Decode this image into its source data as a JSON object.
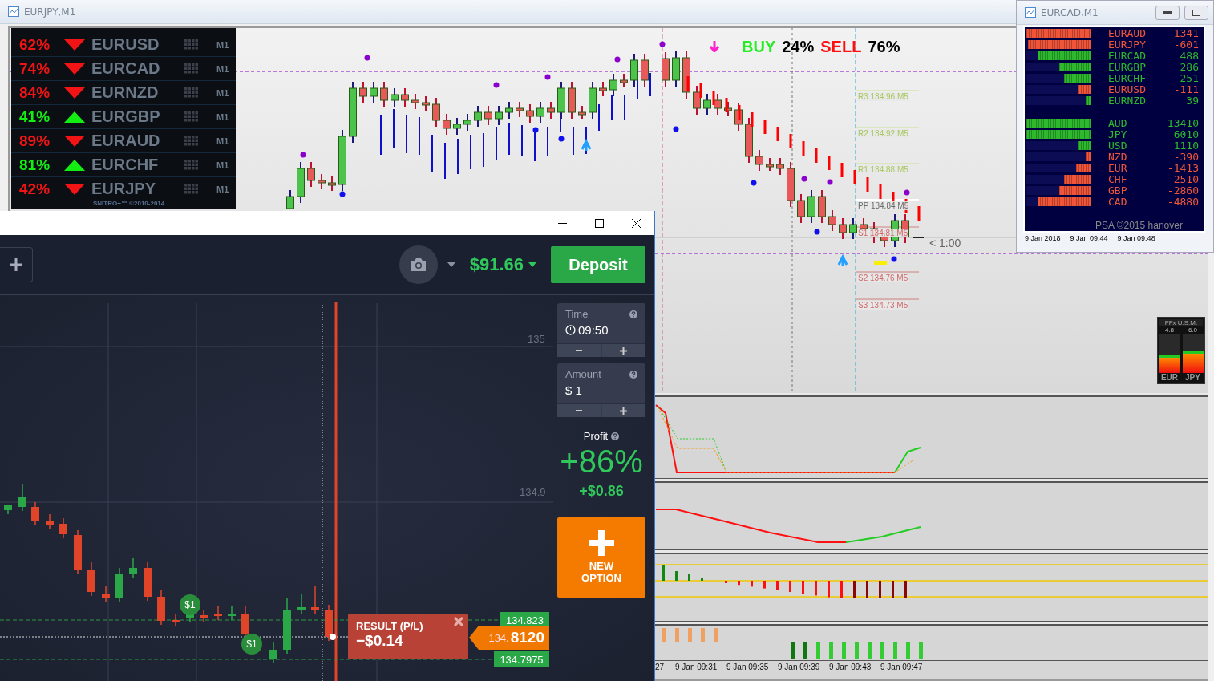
{
  "main_window": {
    "title": "EURJPY,M1"
  },
  "signals": {
    "rows": [
      {
        "percent": "62%",
        "rising": false,
        "pair": "EURUSD",
        "timeframe": "M1"
      },
      {
        "percent": "74%",
        "rising": false,
        "pair": "EURCAD",
        "timeframe": "M1"
      },
      {
        "percent": "84%",
        "rising": false,
        "pair": "EURNZD",
        "timeframe": "M1"
      },
      {
        "percent": "41%",
        "rising": true,
        "pair": "EURGBP",
        "timeframe": "M1"
      },
      {
        "percent": "89%",
        "rising": false,
        "pair": "EURAUD",
        "timeframe": "M1"
      },
      {
        "percent": "81%",
        "rising": true,
        "pair": "EURCHF",
        "timeframe": "M1"
      },
      {
        "percent": "42%",
        "rising": false,
        "pair": "EURJPY",
        "timeframe": "M1"
      }
    ],
    "credit": "SNITRO+™ ©2010-2014"
  },
  "sentiment": {
    "buy_label": "BUY",
    "buy_value": "24%",
    "sell_label": "SELL",
    "sell_value": "76%"
  },
  "pivots": [
    {
      "label": "R3 134.96 M5",
      "kind": "resistance"
    },
    {
      "label": "R2 134.92 M5",
      "kind": "resistance"
    },
    {
      "label": "R1 134.88 M5",
      "kind": "resistance"
    },
    {
      "label": "PP 134.84 M5",
      "kind": "pivot"
    },
    {
      "label": "S1 134.81 M5",
      "kind": "support"
    },
    {
      "label": "S2 134.76 M5",
      "kind": "support"
    },
    {
      "label": "S3 134.73 M5",
      "kind": "support"
    }
  ],
  "countdown": "< 1:00",
  "strength_meter": {
    "title": "FFx U.S.M.",
    "columns": [
      {
        "value": "4.8",
        "currency": "EUR",
        "level": 0.45
      },
      {
        "value": "6.0",
        "currency": "JPY",
        "level": 0.55
      }
    ]
  },
  "time_axis": [
    "27",
    "9 Jan 09:31",
    "9 Jan 09:35",
    "9 Jan 09:39",
    "9 Jan 09:43",
    "9 Jan 09:47"
  ],
  "strength_window": {
    "title": "EURCAD,M1",
    "pairs": [
      {
        "name": "EURAUD",
        "value": "-1341",
        "level": 1.0,
        "color": "#f0553a"
      },
      {
        "name": "EURJPY",
        "value": "-601",
        "level": 0.98,
        "color": "#f0553a"
      },
      {
        "name": "EURCAD",
        "value": "488",
        "level": 0.83,
        "color": "#2db82d"
      },
      {
        "name": "EURGBP",
        "value": "286",
        "level": 0.49,
        "color": "#2db82d"
      },
      {
        "name": "EURCHF",
        "value": "251",
        "level": 0.41,
        "color": "#2db82d"
      },
      {
        "name": "EURUSD",
        "value": "-111",
        "level": 0.19,
        "color": "#f0553a"
      },
      {
        "name": "EURNZD",
        "value": "39",
        "level": 0.08,
        "color": "#2db82d"
      }
    ],
    "currencies": [
      {
        "name": "AUD",
        "value": "13410",
        "level": 1.0,
        "color": "#2db82d"
      },
      {
        "name": "JPY",
        "value": "6010",
        "level": 1.0,
        "color": "#2db82d"
      },
      {
        "name": "USD",
        "value": "1110",
        "level": 0.19,
        "color": "#2db82d"
      },
      {
        "name": "NZD",
        "value": "-390",
        "level": 0.08,
        "color": "#f0553a"
      },
      {
        "name": "EUR",
        "value": "-1413",
        "level": 0.23,
        "color": "#f0553a"
      },
      {
        "name": "CHF",
        "value": "-2510",
        "level": 0.41,
        "color": "#f0553a"
      },
      {
        "name": "GBP",
        "value": "-2860",
        "level": 0.49,
        "color": "#f0553a"
      },
      {
        "name": "CAD",
        "value": "-4880",
        "level": 0.83,
        "color": "#f0553a"
      }
    ],
    "footer": "PSA ©2015 hanover",
    "time_axis": [
      "9 Jan 2018",
      "9 Jan 09:44",
      "9 Jan 09:48"
    ]
  },
  "trade_window": {
    "balance": "$91.66",
    "deposit": "Deposit",
    "price_scale": [
      "135",
      "134.9"
    ],
    "markers": [
      "$1",
      "$1"
    ],
    "result": {
      "title": "RESULT (P/L)",
      "value": "−$0.14"
    },
    "price_tags": {
      "upper": "134.823",
      "current_prefix": "134.",
      "current_main": "8120",
      "lower": "134.7975"
    },
    "time": {
      "label": "Time",
      "value": "09:50"
    },
    "amount": {
      "label": "Amount",
      "value": "$ 1"
    },
    "profit": {
      "label": "Profit",
      "percent": "+86%",
      "value": "+$0.86"
    },
    "new_option": "NEW OPTION"
  }
}
